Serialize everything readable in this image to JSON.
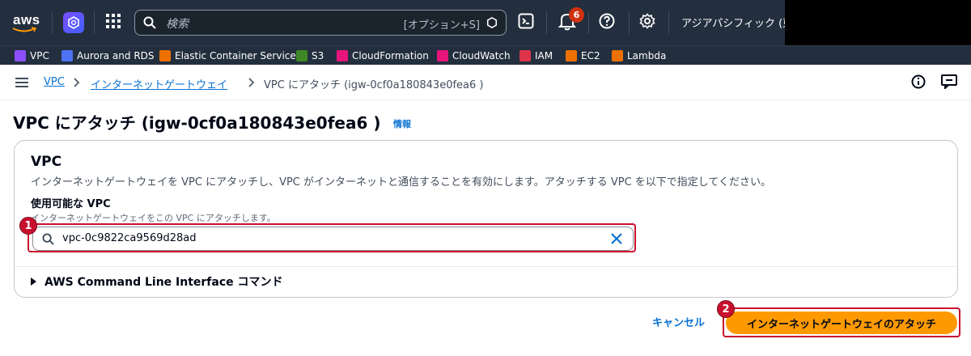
{
  "topnav": {
    "logo_text": "aws",
    "search_placeholder": "検索",
    "search_shortcut": "[オプション+S]",
    "notification_count": "6",
    "region": "アジアパシフィック (東京)"
  },
  "favorites": [
    {
      "label": "VPC",
      "color": "#8c4fff"
    },
    {
      "label": "Aurora and RDS",
      "color": "#4d72f3"
    },
    {
      "label": "Elastic Container Service",
      "color": "#ed7100"
    },
    {
      "label": "S3",
      "color": "#3f8624"
    },
    {
      "label": "CloudFormation",
      "color": "#e7157b"
    },
    {
      "label": "CloudWatch",
      "color": "#e7157b"
    },
    {
      "label": "IAM",
      "color": "#dd344c"
    },
    {
      "label": "EC2",
      "color": "#ed7100"
    },
    {
      "label": "Lambda",
      "color": "#ed7100"
    }
  ],
  "breadcrumb": {
    "items": [
      "VPC",
      "インターネットゲートウェイ",
      "VPC にアタッチ (igw-0cf0a180843e0fea6 )"
    ]
  },
  "page": {
    "title": "VPC にアタッチ (igw-0cf0a180843e0fea6 )",
    "info_label": "情報"
  },
  "panel": {
    "heading": "VPC",
    "description": "インターネットゲートウェイを VPC にアタッチし、VPC がインターネットと通信することを有効にします。アタッチする VPC を以下で指定してください。",
    "field_label": "使用可能な VPC",
    "field_hint": "インターネットゲートウェイをこの VPC にアタッチします。",
    "field_value": "vpc-0c9822ca9569d28ad",
    "cli_expander": "AWS Command Line Interface コマンド"
  },
  "actions": {
    "cancel_label": "キャンセル",
    "attach_label": "インターネットゲートウェイのアタッチ"
  },
  "annotations": {
    "marker1": "1",
    "marker2": "2"
  },
  "colors": {
    "nav_bg": "#232f3e",
    "link": "#0972d3",
    "primary": "#ff9900",
    "annotation": "#c8102e"
  }
}
